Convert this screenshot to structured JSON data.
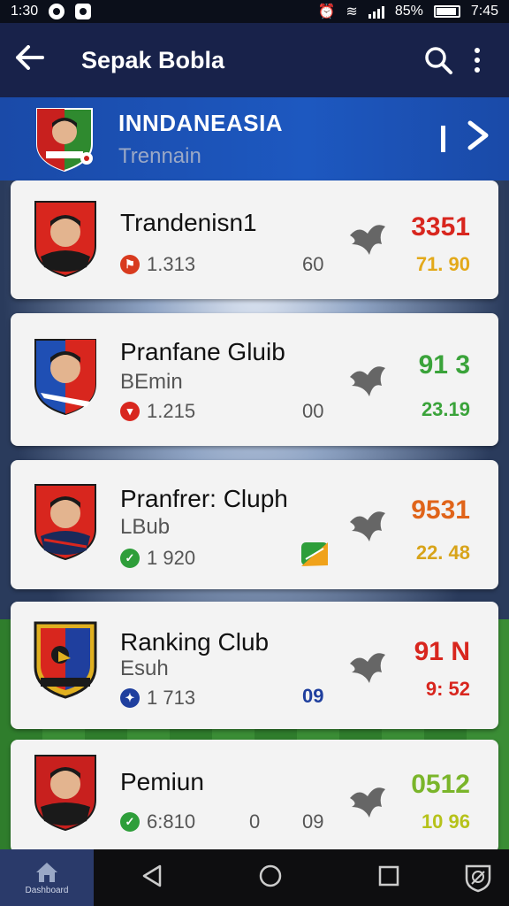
{
  "status_bar": {
    "time": "1:30",
    "battery": "85%",
    "right_time": "7:45"
  },
  "app_bar": {
    "title": "Sepak Bobla",
    "back_icon": "arrow-back-icon",
    "search_icon": "search-icon",
    "more_icon": "more-vert-icon"
  },
  "banner": {
    "team_name": "INNDANEASIA",
    "subtitle": "Trennain",
    "next_icon": "chevron-right-icon"
  },
  "clubs": [
    {
      "name": "Trandenisn1",
      "sub": "",
      "meta": "1.313",
      "mid": "60",
      "score": "3351",
      "score2": "71. 90",
      "badge_color": "#d83a1e",
      "score_color": "#d8261e",
      "score2_color": "#e3a91a"
    },
    {
      "name": "Pranfane Gluib",
      "sub": "BEmin",
      "meta": "1.215",
      "mid": "00",
      "score": "91 3",
      "score2": "23.19",
      "badge_color": "#d8261e",
      "score_color": "#3aa33a",
      "score2_color": "#3aa33a"
    },
    {
      "name": "Pranfrer: Cluph",
      "sub": "LBub",
      "meta": "1 920",
      "mid": "",
      "score": "9531",
      "score2": "22. 48",
      "badge_color": "#2e9e3a",
      "score_color": "#e0641a",
      "score2_color": "#d8a41a"
    },
    {
      "name": "Ranking Club",
      "sub": "Esuh",
      "meta": "1 713",
      "mid": "09",
      "score": "91 N",
      "score2": "9: 52",
      "badge_color": "#1f3f9e",
      "score_color": "#d8261e",
      "score2_color": "#d8261e"
    },
    {
      "name": "Pemiun",
      "sub": "",
      "meta": "6:810",
      "mid": "0",
      "mid2": "09",
      "score": "0512",
      "score2": "10 96",
      "badge_color": "#2e9e3a",
      "score_color": "#7ab52a",
      "score2_color": "#b6c21a"
    }
  ],
  "bottom_nav": {
    "home_label": "Dashboard",
    "home_icon": "home-icon",
    "back_icon": "triangle-back-icon",
    "home_circle_icon": "circle-home-icon",
    "recents_icon": "square-recents-icon",
    "shield_icon": "shield-icon"
  }
}
